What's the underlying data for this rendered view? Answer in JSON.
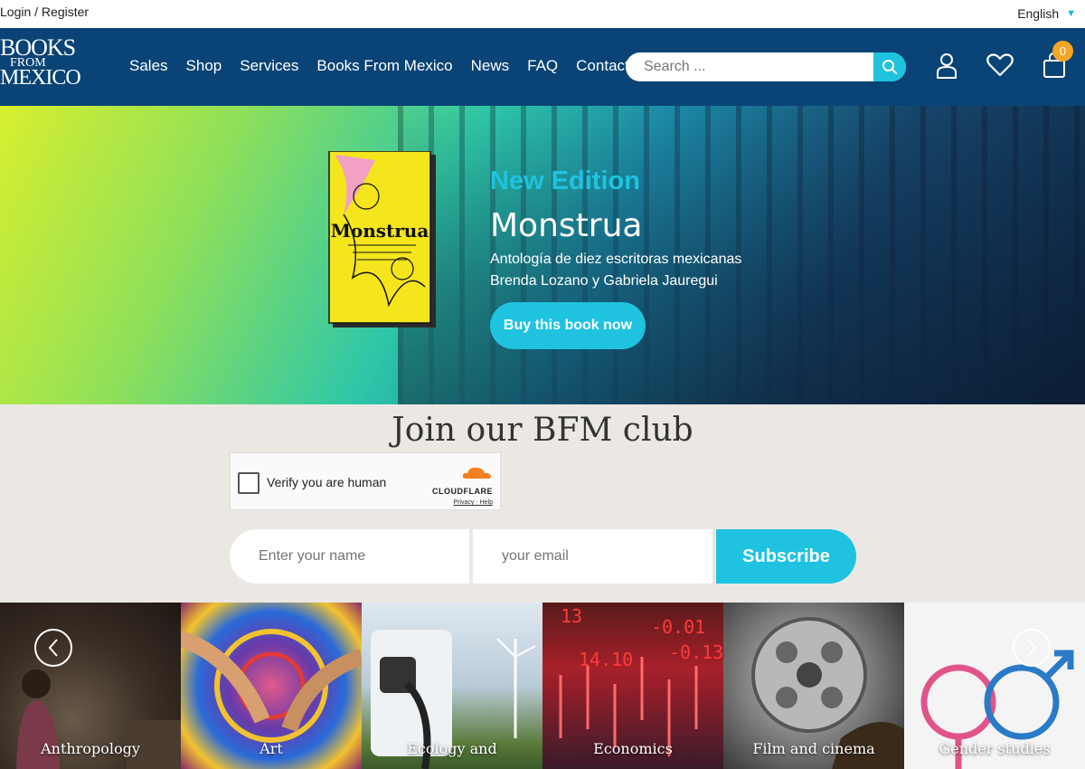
{
  "topbar": {
    "login": "Login / Register",
    "language": "English"
  },
  "logo": {
    "line1": "BOOKS",
    "line2": "FROM",
    "line3": "MEXICO"
  },
  "nav": [
    "Sales",
    "Shop",
    "Services",
    "Books From Mexico",
    "News",
    "FAQ",
    "Contact"
  ],
  "search": {
    "placeholder": "Search ..."
  },
  "cart": {
    "count": "0"
  },
  "hero": {
    "edition": "New Edition",
    "title": "Monstrua",
    "subtitle1": "Antología de diez escritoras mexicanas",
    "subtitle2": "Brenda Lozano y Gabriela Jauregui",
    "button": "Buy this book now",
    "book_cover_text": "Monstrua"
  },
  "club": {
    "title": "Join our BFM club",
    "captcha_label": "Verify you are human",
    "captcha_brand": "CLOUDFLARE",
    "captcha_links": "Privacy · Help",
    "name_placeholder": "Enter your name",
    "email_placeholder": "your email",
    "subscribe": "Subscribe"
  },
  "categories": [
    {
      "label": "Anthropology"
    },
    {
      "label": "Art"
    },
    {
      "label": "Ecology and"
    },
    {
      "label": "Economics"
    },
    {
      "label": "Film and cinema"
    },
    {
      "label": "Gender studies"
    }
  ],
  "colors": {
    "nav_bg": "#0a4476",
    "accent": "#1fc3e0",
    "badge": "#f5a623",
    "club_bg": "#ebe8e4"
  }
}
